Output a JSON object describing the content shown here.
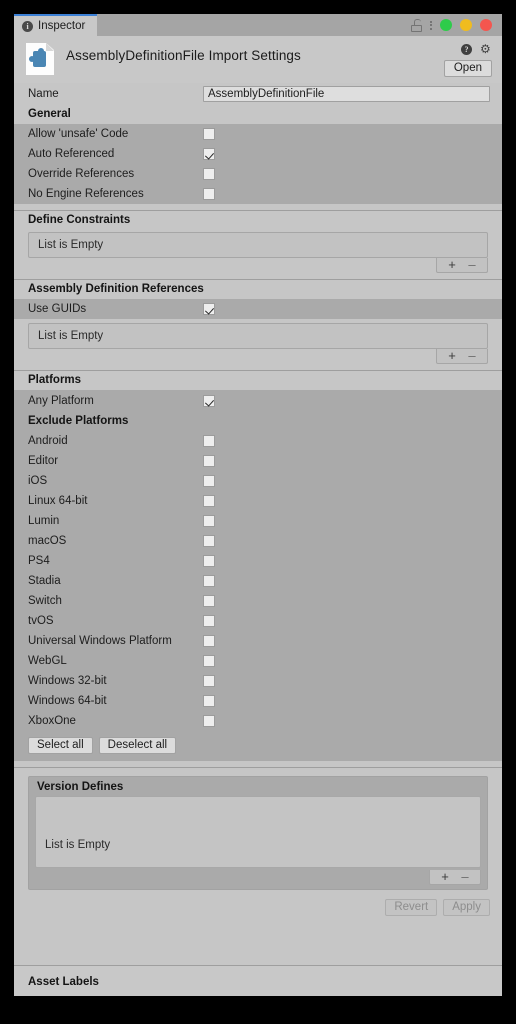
{
  "window": {
    "tab_label": "Inspector",
    "tab_icon": "info-circle-icon",
    "lock_icon": "lock-open-icon",
    "menu_icon": "kebab-menu-icon",
    "traffic_lights": [
      {
        "name": "maximize-button",
        "color": "#2ecc4a"
      },
      {
        "name": "minimize-button",
        "color": "#f0bc1e"
      },
      {
        "name": "close-button",
        "color": "#f4564f"
      }
    ]
  },
  "header": {
    "title": "AssemblyDefinitionFile Import Settings",
    "asset_icon": "assembly-definition-file-icon",
    "help_icon": "help-icon",
    "gear_icon": "gear-icon",
    "open_label": "Open"
  },
  "name_field": {
    "label": "Name",
    "value": "AssemblyDefinitionFile",
    "placeholder": "Name"
  },
  "general": {
    "title": "General",
    "options": [
      {
        "label": "Allow 'unsafe' Code",
        "checked": false
      },
      {
        "label": "Auto Referenced",
        "checked": true
      },
      {
        "label": "Override References",
        "checked": false
      },
      {
        "label": "No Engine References",
        "checked": false
      }
    ]
  },
  "define_constraints": {
    "title": "Define Constraints",
    "empty_text": "List is Empty",
    "add_label": "+",
    "remove_label": "–"
  },
  "assembly_definition_references": {
    "title": "Assembly Definition References",
    "use_guids_label": "Use GUIDs",
    "use_guids_checked": true,
    "empty_text": "List is Empty",
    "add_label": "+",
    "remove_label": "–"
  },
  "platforms": {
    "title": "Platforms",
    "any_platform_label": "Any Platform",
    "any_platform_checked": true,
    "exclude_title": "Exclude Platforms",
    "items": [
      {
        "label": "Android",
        "checked": false
      },
      {
        "label": "Editor",
        "checked": false
      },
      {
        "label": "iOS",
        "checked": false
      },
      {
        "label": "Linux 64-bit",
        "checked": false
      },
      {
        "label": "Lumin",
        "checked": false
      },
      {
        "label": "macOS",
        "checked": false
      },
      {
        "label": "PS4",
        "checked": false
      },
      {
        "label": "Stadia",
        "checked": false
      },
      {
        "label": "Switch",
        "checked": false
      },
      {
        "label": "tvOS",
        "checked": false
      },
      {
        "label": "Universal Windows Platform",
        "checked": false
      },
      {
        "label": "WebGL",
        "checked": false
      },
      {
        "label": "Windows 32-bit",
        "checked": false
      },
      {
        "label": "Windows 64-bit",
        "checked": false
      },
      {
        "label": "XboxOne",
        "checked": false
      }
    ],
    "select_all_label": "Select all",
    "deselect_all_label": "Deselect all"
  },
  "version_defines": {
    "title": "Version Defines",
    "empty_text": "List is Empty",
    "add_label": "+",
    "remove_label": "–"
  },
  "actions": {
    "revert_label": "Revert",
    "apply_label": "Apply"
  },
  "footer": {
    "asset_labels_title": "Asset Labels"
  }
}
